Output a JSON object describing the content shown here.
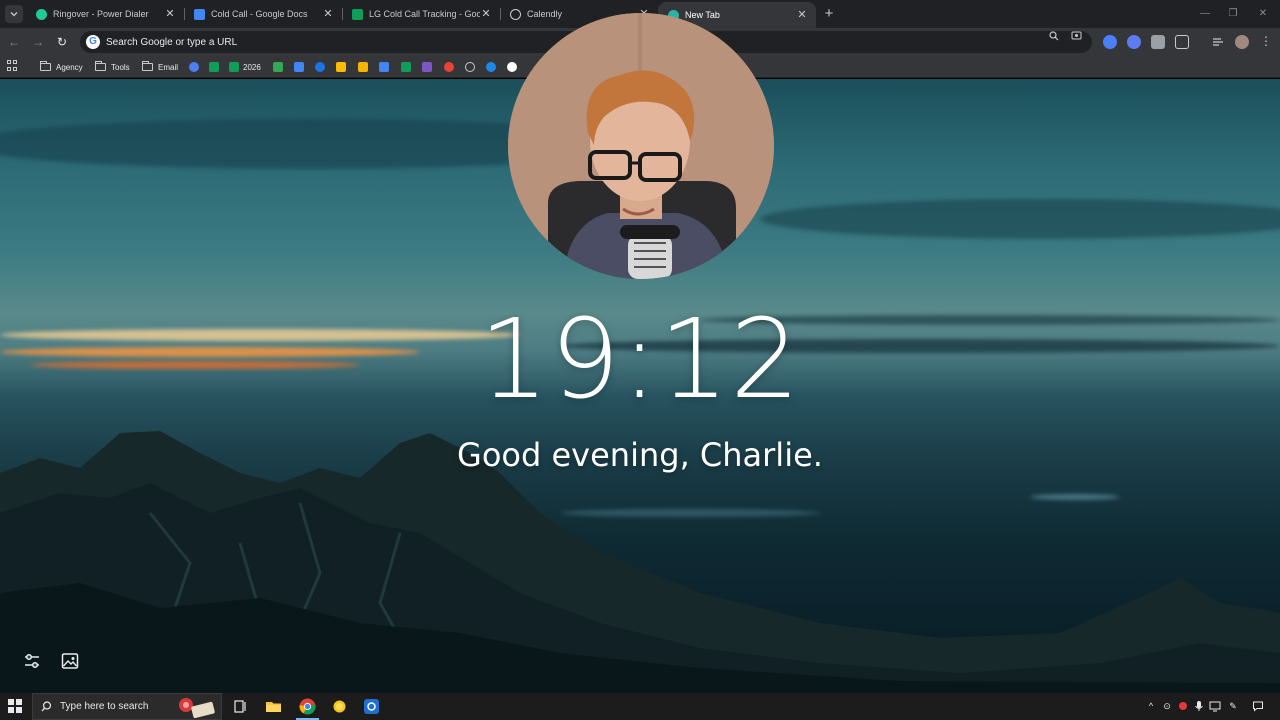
{
  "tabs": [
    {
      "title": "Ringover - Power Dialer",
      "favicon": "ringover-icon",
      "active": false
    },
    {
      "title": "Cold Call - Google Docs",
      "favicon": "google-docs-icon",
      "active": false
    },
    {
      "title": "LG Cold Call Tracking - Google",
      "favicon": "google-sheets-icon",
      "active": false
    },
    {
      "title": "Calendly",
      "favicon": "calendly-icon",
      "active": false
    },
    {
      "title": "New Tab",
      "favicon": "new-tab-icon",
      "active": true
    }
  ],
  "omnibox": {
    "placeholder": "Search Google or type a URL"
  },
  "bookmarks": {
    "folders": [
      "Agency",
      "Tools",
      "Email"
    ],
    "sheet_bookmark": "2026"
  },
  "ntp": {
    "time": "19:12",
    "greeting": "Good evening, Charlie."
  },
  "taskbar": {
    "search_placeholder": "Type here to search"
  },
  "colors": {
    "tabstrip": "#202124",
    "toolbar": "#35363a",
    "docs_blue": "#4285f4",
    "sheets_green": "#0f9d58",
    "taskbar": "#1c1c1c"
  }
}
